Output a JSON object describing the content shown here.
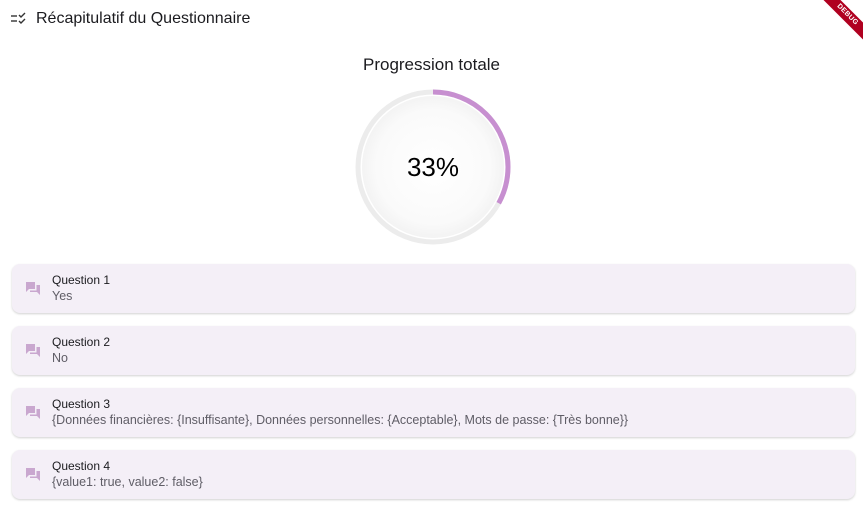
{
  "header": {
    "title": "Récapitulatif du Questionnaire",
    "icon": "checklist-icon"
  },
  "debug_banner": "DEBUG",
  "progress": {
    "title": "Progression totale",
    "value_label": "33%",
    "fraction": 0.33,
    "accent_color": "#c78fd0",
    "track_color": "#ececec"
  },
  "questions": [
    {
      "title": "Question 1",
      "answer": "Yes"
    },
    {
      "title": "Question 2",
      "answer": "No"
    },
    {
      "title": "Question 3",
      "answer": "{Données financières: {Insuffisante}, Données personnelles: {Acceptable}, Mots de passe: {Très bonne}}"
    },
    {
      "title": "Question 4",
      "answer": "{value1: true, value2: false}"
    }
  ],
  "colors": {
    "card_bg": "#f4eff7",
    "card_icon": "#c9a7cf"
  }
}
